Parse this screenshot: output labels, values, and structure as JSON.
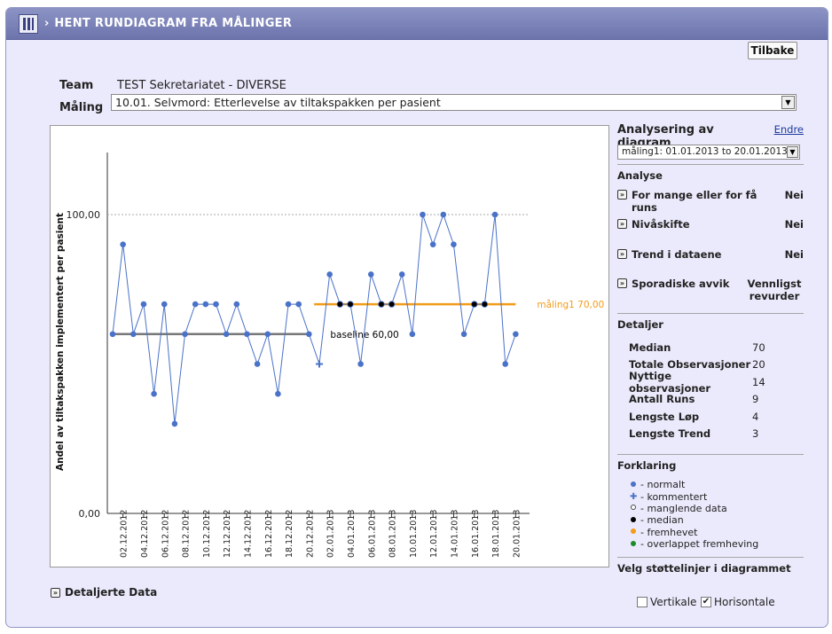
{
  "header": {
    "title": "HENT RUNDIAGRAM FRA MÅLINGER"
  },
  "toolbar": {
    "back_label": "Tilbake"
  },
  "form": {
    "team_label": "Team",
    "team_value": "TEST Sekretariatet - DIVERSE",
    "maaling_label": "Måling",
    "maaling_value": "10.01. Selvmord: Etterlevelse av tiltakspakken per pasient"
  },
  "side": {
    "title": "Analysering av diagram",
    "edit_link": "Endre",
    "period_value": "måling1: 01.01.2013 to 20.01.2013",
    "analyse_title": "Analyse",
    "analyses": [
      {
        "label": "For mange eller for få runs",
        "result": "Nei"
      },
      {
        "label": "Nivåskifte",
        "result": "Nei"
      },
      {
        "label": "Trend i dataene",
        "result": "Nei"
      },
      {
        "label": "Sporadiske avvik",
        "result": "Vennligst revurder"
      }
    ],
    "details_title": "Detaljer",
    "details": [
      {
        "label": "Median",
        "value": "70"
      },
      {
        "label": "Totale Observasjoner",
        "value": "20"
      },
      {
        "label": "Nyttige observasjoner",
        "value": "14"
      },
      {
        "label": "Antall Runs",
        "value": "9"
      },
      {
        "label": "Lengste Løp",
        "value": "4"
      },
      {
        "label": "Lengste Trend",
        "value": "3"
      }
    ],
    "legend_title": "Forklaring",
    "legend": [
      {
        "label": "- normalt",
        "color": "#4a72c8",
        "mark": "dot"
      },
      {
        "label": "- kommentert",
        "color": "#4a72c8",
        "mark": "plus"
      },
      {
        "label": "- manglende data",
        "color": "#ffffff",
        "mark": "ring"
      },
      {
        "label": "- median",
        "color": "#000000",
        "mark": "dot"
      },
      {
        "label": "- fremhevet",
        "color": "#f39b1a",
        "mark": "dot"
      },
      {
        "label": "- overlappet fremheving",
        "color": "#1d8a2a",
        "mark": "dot"
      }
    ],
    "support_title": "Velg støttelinjer i diagrammet",
    "support_vertical": "Vertikale",
    "support_horizontal": "Horisontale",
    "support_vertical_checked": false,
    "support_horizontal_checked": true
  },
  "bottom": {
    "detailed_data_label": "Detaljerte Data"
  },
  "chart_data": {
    "type": "line",
    "ylabel": "Andel av tiltakspakken implementert per pasient",
    "ylim": [
      0,
      100
    ],
    "yticks": [
      "0,00",
      "100,00"
    ],
    "xtick_labels": [
      "02.12.2012",
      "04.12.2012",
      "06.12.2012",
      "08.12.2012",
      "10.12.2012",
      "12.12.2012",
      "14.12.2012",
      "16.12.2012",
      "18.12.2012",
      "20.12.2012",
      "02.01.2013",
      "04.01.2013",
      "06.01.2013",
      "08.01.2013",
      "10.01.2013",
      "12.01.2013",
      "14.01.2013",
      "16.01.2013",
      "18.01.2013",
      "20.01.2013"
    ],
    "series": [
      {
        "name": "",
        "color": "#4a72c8",
        "values": [
          60,
          90,
          60,
          70,
          40,
          70,
          30,
          60,
          70,
          70,
          70,
          60,
          70,
          60,
          50,
          60,
          40,
          70,
          70,
          60,
          50,
          80,
          70,
          70,
          50,
          80,
          70,
          70,
          80,
          60,
          100,
          90,
          100,
          90,
          60,
          70,
          70,
          100,
          50,
          60
        ],
        "point_types": [
          "n",
          "n",
          "n",
          "n",
          "n",
          "n",
          "n",
          "n",
          "n",
          "n",
          "n",
          "n",
          "n",
          "n",
          "n",
          "n",
          "n",
          "n",
          "n",
          "n",
          "c",
          "n",
          "m",
          "m",
          "n",
          "n",
          "m",
          "m",
          "n",
          "n",
          "n",
          "n",
          "n",
          "n",
          "n",
          "m",
          "m",
          "n",
          "n",
          "n"
        ]
      }
    ],
    "reference_lines": [
      {
        "label": "baseline 60,00",
        "value": 60,
        "from_index": 0,
        "to_index": 19,
        "color": "#777777",
        "label_color": "#000000"
      },
      {
        "label": "måling1 70,00",
        "value": 70,
        "from_index": 19.5,
        "to_index": 39,
        "color": "#f39b1a",
        "label_color": "#f39b1a"
      }
    ],
    "grid": false
  }
}
